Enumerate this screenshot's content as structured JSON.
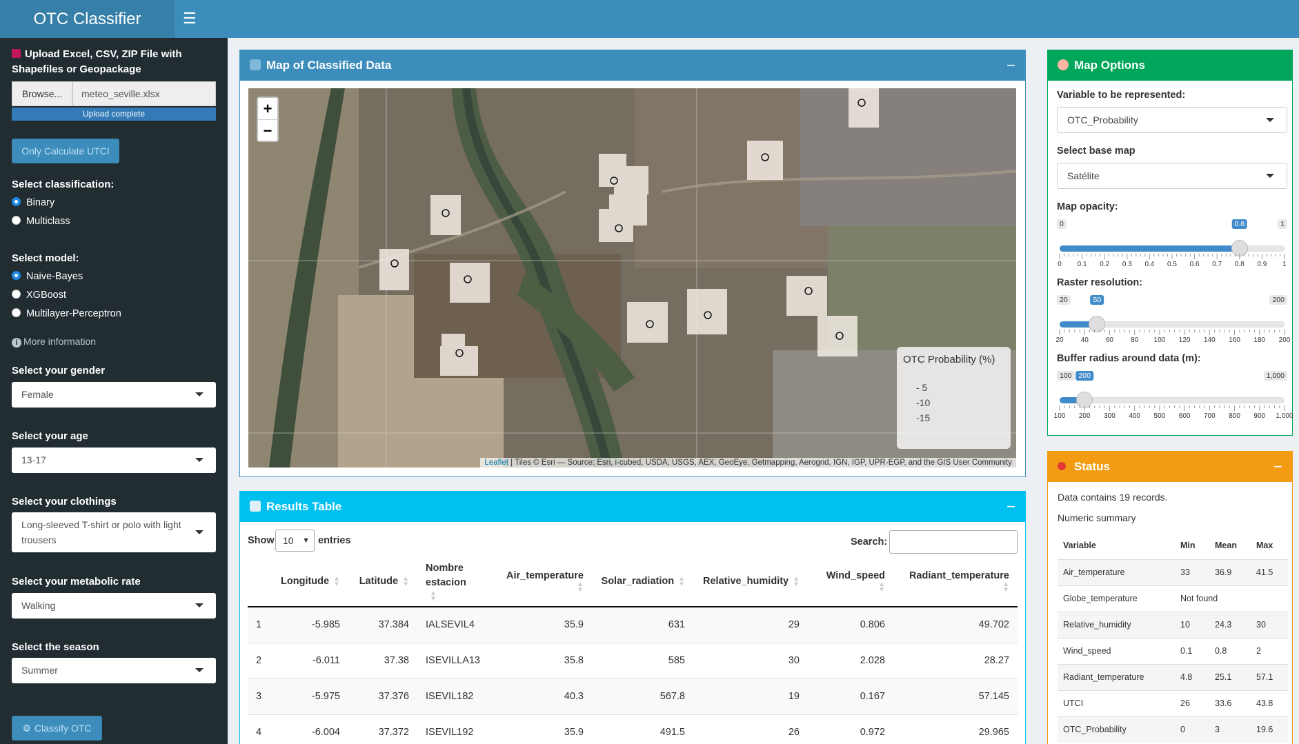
{
  "app": {
    "title": "OTC Classifier"
  },
  "sidebar": {
    "upload_label": "Upload Excel, CSV, ZIP File with Shapefiles or Geopackage",
    "browse_label": "Browse...",
    "file_name": "meteo_seville.xlsx",
    "upload_status": "Upload complete",
    "upload_progress": 1.0,
    "only_utci_label": "Only Calculate UTCI",
    "classification_label": "Select classification:",
    "classification_options": [
      "Binary",
      "Multiclass"
    ],
    "classification_selected": "Binary",
    "model_label": "Select model:",
    "model_options": [
      "Naive-Bayes",
      "XGBoost",
      "Multilayer-Perceptron"
    ],
    "model_selected": "Naive-Bayes",
    "more_info": "More information",
    "gender_label": "Select your gender",
    "gender_value": "Female",
    "age_label": "Select your age",
    "age_value": "13-17",
    "clothing_label": "Select your clothings",
    "clothing_value": "Long-sleeved T-shirt or polo with light trousers",
    "metabolic_label": "Select your metabolic rate",
    "metabolic_value": "Walking",
    "season_label": "Select the season",
    "season_value": "Summer",
    "classify_label": "Classify OTC"
  },
  "map_box": {
    "title": "Map of Classified Data",
    "zoom_in": "+",
    "zoom_out": "−",
    "legend_title": "OTC Probability (%)",
    "legend_items": [
      "- 5",
      "-10",
      "-15"
    ],
    "attribution_link": "Leaflet",
    "attribution_text": " | Tiles © Esri — Source: Esri, i-cubed, USDA, USGS, AEX, GeoEye, Getmapping, Aerogrid, IGN, IGP, UPR-EGP, and the GIS User Community"
  },
  "options": {
    "title": "Map Options",
    "variable_label": "Variable to be represented:",
    "variable_value": "OTC_Probability",
    "basemap_label": "Select base map",
    "basemap_value": "Satélite",
    "opacity": {
      "label": "Map opacity:",
      "min": 0,
      "max": 1,
      "value": 0.8,
      "min_label": "0",
      "max_label": "1",
      "value_label": "0.8",
      "ticks": [
        "0",
        "0.1",
        "0.2",
        "0.3",
        "0.4",
        "0.5",
        "0.6",
        "0.7",
        "0.8",
        "0.9",
        "1"
      ]
    },
    "resolution": {
      "label": "Raster resolution:",
      "min": 20,
      "max": 200,
      "value": 50,
      "min_label": "20",
      "max_label": "200",
      "value_label": "50",
      "ticks": [
        "20",
        "40",
        "60",
        "80",
        "100",
        "120",
        "140",
        "160",
        "180",
        "200"
      ]
    },
    "buffer": {
      "label": "Buffer radius around data (m):",
      "min": 100,
      "max": 1000,
      "value": 200,
      "min_label": "100",
      "max_label": "1,000",
      "value_label": "200",
      "ticks": [
        "100",
        "200",
        "300",
        "400",
        "500",
        "600",
        "700",
        "800",
        "900",
        "1,000"
      ]
    }
  },
  "results": {
    "title": "Results Table",
    "show_label": "Show",
    "entries_value": "10",
    "entries_label": "entries",
    "search_label": "Search:",
    "columns": [
      "",
      "Longitude",
      "Latitude",
      "Nombre estacion",
      "Air_temperature",
      "Solar_radiation",
      "Relative_humidity",
      "Wind_speed",
      "Radiant_temperature"
    ],
    "rows": [
      [
        "1",
        "-5.985",
        "37.384",
        "IALSEVIL4",
        "35.9",
        "631",
        "29",
        "0.806",
        "49.702"
      ],
      [
        "2",
        "-6.011",
        "37.38",
        "ISEVILLA13",
        "35.8",
        "585",
        "30",
        "2.028",
        "28.27"
      ],
      [
        "3",
        "-5.975",
        "37.376",
        "ISEVIL182",
        "40.3",
        "567.8",
        "19",
        "0.167",
        "57.145"
      ],
      [
        "4",
        "-6.004",
        "37.372",
        "ISEVIL192",
        "35.9",
        "491.5",
        "26",
        "0.972",
        "29.965"
      ]
    ]
  },
  "status": {
    "title": "Status",
    "records": "Data contains 19 records.",
    "summary_label": "Numeric summary",
    "columns": [
      "Variable",
      "Min",
      "Mean",
      "Max"
    ],
    "rows": [
      [
        "Air_temperature",
        "33",
        "36.9",
        "41.5"
      ],
      [
        "Globe_temperature",
        "Not found",
        "",
        ""
      ],
      [
        "Relative_humidity",
        "10",
        "24.3",
        "30"
      ],
      [
        "Wind_speed",
        "0.1",
        "0.8",
        "2"
      ],
      [
        "Radiant_temperature",
        "4.8",
        "25.1",
        "57.1"
      ],
      [
        "UTCI",
        "26",
        "33.6",
        "43.8"
      ],
      [
        "OTC_Probability",
        "0",
        "3",
        "19.6"
      ]
    ]
  },
  "colors": {
    "header": "#3c8dbc",
    "sidebar": "#222d32",
    "map_box": "#3c8dbc",
    "options_box": "#00a65a",
    "results_box": "#00c0ef",
    "status_box": "#f39c12"
  }
}
